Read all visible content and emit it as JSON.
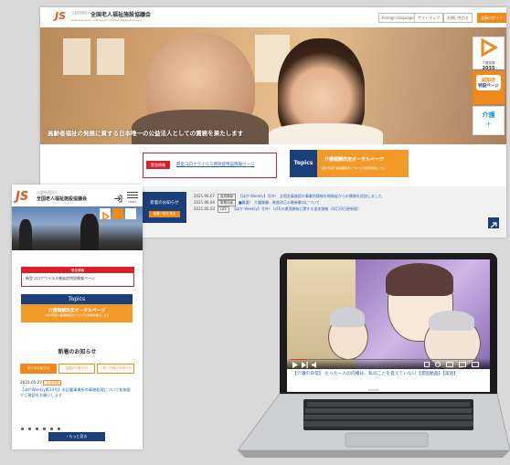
{
  "desktop": {
    "logo_mark": "JS",
    "org_prefix": "公益社団法人",
    "org_name": "全国老人福祉施設協議会",
    "org_sub": "Japanese Council of Senior Citizens Welfare Service",
    "header_links": [
      "Foreign language",
      "サイトマップ",
      "お問い合わせ",
      "会員ログイン"
    ],
    "hero_caption": "高齢者福祉の発展に資する日本唯一の公益法人としての責務を果たします",
    "side_badges": [
      {
        "top": "介護保険",
        "big": "2035"
      },
      {
        "top": "認知症",
        "big": "特設ページ"
      },
      {
        "top": "介護",
        "big": "＋"
      }
    ],
    "news_tag": "緊急情報",
    "news_link": "新型コロナウイルス感染症特設情報ページ",
    "topics_label": "Topics",
    "topics_title": "介護報酬改定ポータルページ",
    "topics_sub": "令和3年度介護報酬改定についての最新情報はこちら",
    "news_box_title": "新着のお知らせ",
    "news_box_more": "新着一覧を見る",
    "news_rows": [
      {
        "date": "2021.06.07",
        "tag": "会員情報",
        "text": "【ほか Weekly】号外！ 全国会員施設の事業所情報を総務省からの情報を追加しました"
      },
      {
        "date": "2021.06.04",
        "tag": "事業計画",
        "text": "■重要！ 介護報酬・制度改正の最新動向について"
      },
      {
        "date": "2021.06.03",
        "tag": "LIFE",
        "text": "【ほか Weekly】号外！ LIFEの運用開始に関する追加情報（6月10日更新版）"
      }
    ]
  },
  "mobile": {
    "logo_mark": "JS",
    "org_prefix": "公益社団法人",
    "org_name": "全国老人福祉施設協議会",
    "icon_labels": [
      "ログイン",
      "MENU"
    ],
    "alert_title": "緊急情報",
    "alert_text": "新型コロナウイルス感染症特設情報ページ",
    "topics_label": "Topics",
    "topics_title": "介護報酬改定ポータルページ",
    "topics_sub": "令和3年度介護報酬改定についての最新情報はこちら",
    "section_title": "新着のお知らせ",
    "tabs": [
      "全てのお知らせ",
      "会員のお知らせ",
      "一般・行政のお知らせ"
    ],
    "news_date": "2021.05.27",
    "news_tag": "会員情報",
    "news_text": "【ほかWeekly第10号】未記載事業所の事務処理について各施設でご確認をお願いします",
    "more_button": "もっと見る",
    "page_dots": 6
  },
  "laptop": {
    "video_caption": "【介護の日常】 たった一人の内緒は、私のことを覚えていない【漫画動画】【実話】",
    "brand": "HUAWEI"
  },
  "colors": {
    "orange": "#ee8a1c",
    "navy": "#1a3f7a",
    "red": "#d8202b",
    "bg": "#d9d9d9"
  }
}
